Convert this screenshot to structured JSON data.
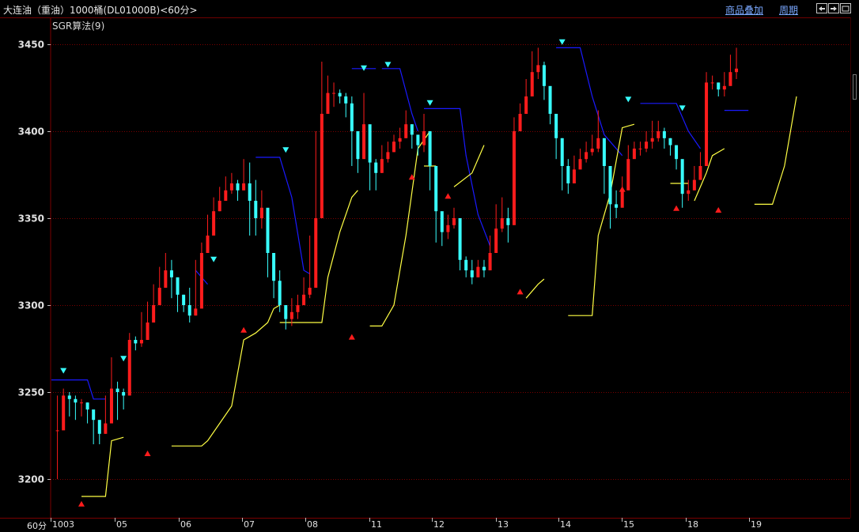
{
  "header": {
    "title": "大连油（重油）1000桶(DL01000B)<60分>",
    "overlay_link": "商品叠加",
    "period_link": "周期"
  },
  "indicator_label": "SGR算法(9)",
  "period_label": "60分",
  "colors": {
    "background": "#000000",
    "grid": "#7a0000",
    "up_candle": "#ff1c1c",
    "down_candle": "#38ffff",
    "upper_line": "#1a1aff",
    "lower_line": "#ffff44",
    "text": "#c0c0c0"
  },
  "icons": [
    "nav-left-icon",
    "nav-right-icon",
    "nav-fit-icon"
  ],
  "chart_data": {
    "type": "candlestick",
    "title": "",
    "ylim": [
      3180,
      3460
    ],
    "yticks": [
      3200,
      3250,
      3300,
      3350,
      3400,
      3450
    ],
    "xtick_labels": [
      "1003",
      "05",
      "06",
      "07",
      "08",
      "11",
      "12",
      "13",
      "14",
      "15",
      "18",
      "19"
    ],
    "grid": true,
    "series": [
      {
        "name": "",
        "role": "price",
        "points": [
          [
            1,
            3228,
            3248,
            3200
          ],
          [
            2,
            3248,
            3252,
            3244
          ],
          [
            3,
            3246,
            3250,
            3236
          ],
          [
            4,
            3244,
            3248,
            3234
          ],
          [
            5,
            3244,
            3246,
            3236
          ],
          [
            6,
            3240,
            3244,
            3232
          ],
          [
            7,
            3234,
            3238,
            3220
          ],
          [
            8,
            3226,
            3232,
            3220
          ],
          [
            9,
            3232,
            3248,
            3226
          ],
          [
            10,
            3252,
            3270,
            3240
          ],
          [
            11,
            3250,
            3256,
            3234
          ],
          [
            12,
            3248,
            3252,
            3240
          ],
          [
            13,
            3280,
            3284,
            3274
          ],
          [
            14,
            3278,
            3282,
            3274
          ],
          [
            15,
            3280,
            3296,
            3276
          ],
          [
            16,
            3290,
            3302,
            3280
          ],
          [
            17,
            3300,
            3312,
            3290
          ],
          [
            18,
            3310,
            3322,
            3300
          ],
          [
            19,
            3320,
            3330,
            3310
          ],
          [
            20,
            3316,
            3326,
            3304
          ],
          [
            21,
            3306,
            3312,
            3296
          ],
          [
            22,
            3300,
            3306,
            3296
          ],
          [
            23,
            3294,
            3310,
            3290
          ],
          [
            24,
            3298,
            3326,
            3294
          ],
          [
            25,
            3330,
            3336,
            3320
          ],
          [
            26,
            3340,
            3352,
            3330
          ],
          [
            27,
            3354,
            3362,
            3346
          ],
          [
            28,
            3360,
            3368,
            3354
          ],
          [
            29,
            3366,
            3374,
            3360
          ],
          [
            30,
            3370,
            3376,
            3364
          ],
          [
            31,
            3366,
            3372,
            3360
          ],
          [
            32,
            3370,
            3384,
            3366
          ],
          [
            33,
            3360,
            3382,
            3340
          ],
          [
            34,
            3350,
            3372,
            3340
          ],
          [
            35,
            3356,
            3366,
            3344
          ],
          [
            36,
            3330,
            3348,
            3316
          ],
          [
            37,
            3314,
            3328,
            3304
          ],
          [
            38,
            3300,
            3320,
            3296
          ],
          [
            39,
            3292,
            3298,
            3286
          ],
          [
            40,
            3296,
            3304,
            3288
          ],
          [
            41,
            3300,
            3306,
            3292
          ],
          [
            42,
            3306,
            3316,
            3300
          ],
          [
            43,
            3310,
            3340,
            3304
          ],
          [
            44,
            3350,
            3400,
            3340
          ],
          [
            45,
            3410,
            3440,
            3400
          ],
          [
            46,
            3422,
            3432,
            3410
          ],
          [
            47,
            3422,
            3428,
            3414
          ],
          [
            48,
            3420,
            3424,
            3416
          ],
          [
            49,
            3416,
            3422,
            3408
          ],
          [
            50,
            3400,
            3420,
            3380
          ],
          [
            51,
            3384,
            3396,
            3376
          ],
          [
            52,
            3404,
            3422,
            3392
          ],
          [
            53,
            3382,
            3398,
            3366
          ],
          [
            54,
            3376,
            3384,
            3366
          ],
          [
            55,
            3384,
            3392,
            3376
          ],
          [
            56,
            3388,
            3394,
            3382
          ],
          [
            57,
            3394,
            3398,
            3388
          ],
          [
            58,
            3396,
            3402,
            3390
          ],
          [
            59,
            3404,
            3412,
            3396
          ],
          [
            60,
            3398,
            3404,
            3390
          ],
          [
            61,
            3392,
            3396,
            3386
          ],
          [
            62,
            3400,
            3410,
            3388
          ],
          [
            63,
            3380,
            3400,
            3366
          ],
          [
            64,
            3354,
            3380,
            3336
          ],
          [
            65,
            3342,
            3352,
            3334
          ],
          [
            66,
            3346,
            3352,
            3338
          ],
          [
            67,
            3350,
            3356,
            3344
          ],
          [
            68,
            3326,
            3330,
            3320
          ],
          [
            69,
            3320,
            3328,
            3316
          ],
          [
            70,
            3316,
            3326,
            3312
          ],
          [
            71,
            3322,
            3326,
            3316
          ],
          [
            72,
            3320,
            3326,
            3316
          ],
          [
            73,
            3330,
            3340,
            3324
          ],
          [
            74,
            3344,
            3358,
            3336
          ],
          [
            75,
            3350,
            3362,
            3342
          ],
          [
            76,
            3346,
            3356,
            3336
          ],
          [
            77,
            3400,
            3408,
            3394
          ],
          [
            78,
            3410,
            3416,
            3402
          ],
          [
            79,
            3420,
            3430,
            3414
          ],
          [
            80,
            3434,
            3446,
            3426
          ],
          [
            81,
            3438,
            3448,
            3430
          ],
          [
            82,
            3426,
            3440,
            3418
          ],
          [
            83,
            3410,
            3424,
            3404
          ],
          [
            84,
            3396,
            3410,
            3384
          ],
          [
            85,
            3380,
            3396,
            3366
          ],
          [
            86,
            3370,
            3384,
            3364
          ],
          [
            87,
            3378,
            3386,
            3372
          ],
          [
            88,
            3384,
            3390,
            3380
          ],
          [
            89,
            3388,
            3394,
            3382
          ],
          [
            90,
            3390,
            3398,
            3386
          ],
          [
            91,
            3396,
            3412,
            3388
          ],
          [
            92,
            3380,
            3396,
            3364
          ],
          [
            93,
            3358,
            3372,
            3344
          ],
          [
            94,
            3356,
            3366,
            3350
          ],
          [
            95,
            3366,
            3374,
            3360
          ],
          [
            96,
            3384,
            3392,
            3376
          ],
          [
            97,
            3390,
            3394,
            3386
          ],
          [
            98,
            3390,
            3394,
            3386
          ],
          [
            99,
            3394,
            3400,
            3388
          ],
          [
            100,
            3396,
            3406,
            3390
          ],
          [
            101,
            3400,
            3406,
            3394
          ],
          [
            102,
            3396,
            3402,
            3390
          ],
          [
            103,
            3392,
            3396,
            3386
          ],
          [
            104,
            3384,
            3388,
            3378
          ],
          [
            105,
            3364,
            3376,
            3356
          ],
          [
            106,
            3366,
            3372,
            3360
          ],
          [
            107,
            3372,
            3380,
            3366
          ],
          [
            108,
            3380,
            3388,
            3374
          ],
          [
            109,
            3428,
            3434,
            3422
          ],
          [
            110,
            3428,
            3432,
            3424
          ],
          [
            111,
            3424,
            3428,
            3420
          ],
          [
            112,
            3426,
            3434,
            3420
          ],
          [
            113,
            3434,
            3444,
            3428
          ],
          [
            114,
            3436,
            3448,
            3430
          ]
        ]
      },
      {
        "name": "",
        "role": "sgr_upper",
        "segments": [
          [
            [
              0,
              3257
            ],
            [
              6,
              3257
            ],
            [
              7,
              3246
            ],
            [
              9,
              3246
            ]
          ],
          [
            [
              24,
              3320
            ],
            [
              26,
              3312
            ]
          ],
          [
            [
              34,
              3385
            ],
            [
              38,
              3385
            ],
            [
              40,
              3362
            ],
            [
              42,
              3320
            ],
            [
              43,
              3318
            ]
          ],
          [
            [
              50,
              3436
            ],
            [
              54,
              3436
            ]
          ],
          [
            [
              55,
              3436
            ],
            [
              58,
              3436
            ],
            [
              60,
              3410
            ],
            [
              61,
              3400
            ]
          ],
          [
            [
              62,
              3413
            ],
            [
              68,
              3413
            ],
            [
              69,
              3386
            ],
            [
              71,
              3352
            ],
            [
              73,
              3334
            ]
          ],
          [
            [
              84,
              3448
            ],
            [
              88,
              3448
            ],
            [
              90,
              3420
            ],
            [
              92,
              3398
            ],
            [
              95,
              3386
            ]
          ],
          [
            [
              98,
              3416
            ],
            [
              104,
              3416
            ],
            [
              106,
              3400
            ],
            [
              108,
              3390
            ]
          ],
          [
            [
              112,
              3412
            ],
            [
              116,
              3412
            ]
          ]
        ]
      },
      {
        "name": "",
        "role": "sgr_lower",
        "segments": [
          [
            [
              5,
              3190
            ],
            [
              9,
              3190
            ],
            [
              10,
              3222
            ],
            [
              12,
              3224
            ]
          ],
          [
            [
              20,
              3219
            ],
            [
              25,
              3219
            ],
            [
              26,
              3222
            ],
            [
              28,
              3232
            ],
            [
              30,
              3242
            ],
            [
              32,
              3280
            ],
            [
              34,
              3284
            ],
            [
              36,
              3290
            ],
            [
              37,
              3298
            ],
            [
              38,
              3300
            ]
          ],
          [
            [
              38,
              3290
            ],
            [
              45,
              3290
            ],
            [
              46,
              3316
            ],
            [
              48,
              3342
            ],
            [
              50,
              3362
            ],
            [
              51,
              3366
            ]
          ],
          [
            [
              53,
              3288
            ],
            [
              55,
              3288
            ],
            [
              57,
              3300
            ],
            [
              59,
              3340
            ],
            [
              61,
              3390
            ],
            [
              63,
              3400
            ]
          ],
          [
            [
              62,
              3380
            ],
            [
              64,
              3380
            ]
          ],
          [
            [
              67,
              3368
            ],
            [
              70,
              3376
            ],
            [
              72,
              3392
            ]
          ],
          [
            [
              79,
              3304
            ],
            [
              81,
              3312
            ],
            [
              82,
              3315
            ]
          ],
          [
            [
              86,
              3294
            ],
            [
              90,
              3294
            ],
            [
              91,
              3340
            ],
            [
              93,
              3364
            ],
            [
              95,
              3402
            ],
            [
              97,
              3404
            ]
          ],
          [
            [
              103,
              3370
            ],
            [
              106,
              3370
            ]
          ],
          [
            [
              107,
              3360
            ],
            [
              109,
              3376
            ],
            [
              110,
              3386
            ],
            [
              112,
              3390
            ]
          ],
          [
            [
              117,
              3358
            ],
            [
              120,
              3358
            ],
            [
              122,
              3380
            ],
            [
              124,
              3420
            ]
          ]
        ]
      }
    ],
    "markers": [
      {
        "type": "sell",
        "x": 2,
        "y": 3262
      },
      {
        "type": "sell",
        "x": 12,
        "y": 3269
      },
      {
        "type": "sell",
        "x": 27,
        "y": 3326
      },
      {
        "type": "sell",
        "x": 39,
        "y": 3389
      },
      {
        "type": "sell",
        "x": 52,
        "y": 3436
      },
      {
        "type": "sell",
        "x": 56,
        "y": 3438
      },
      {
        "type": "sell",
        "x": 63,
        "y": 3416
      },
      {
        "type": "sell",
        "x": 85,
        "y": 3451
      },
      {
        "type": "sell",
        "x": 96,
        "y": 3418
      },
      {
        "type": "sell",
        "x": 105,
        "y": 3413
      },
      {
        "type": "buy",
        "x": 5,
        "y": 3186
      },
      {
        "type": "buy",
        "x": 16,
        "y": 3215
      },
      {
        "type": "buy",
        "x": 32,
        "y": 3286
      },
      {
        "type": "buy",
        "x": 50,
        "y": 3282
      },
      {
        "type": "buy",
        "x": 60,
        "y": 3374
      },
      {
        "type": "buy",
        "x": 66,
        "y": 3363
      },
      {
        "type": "buy",
        "x": 78,
        "y": 3308
      },
      {
        "type": "buy",
        "x": 95,
        "y": 3367
      },
      {
        "type": "buy",
        "x": 104,
        "y": 3356
      },
      {
        "type": "buy",
        "x": 111,
        "y": 3355
      }
    ]
  }
}
